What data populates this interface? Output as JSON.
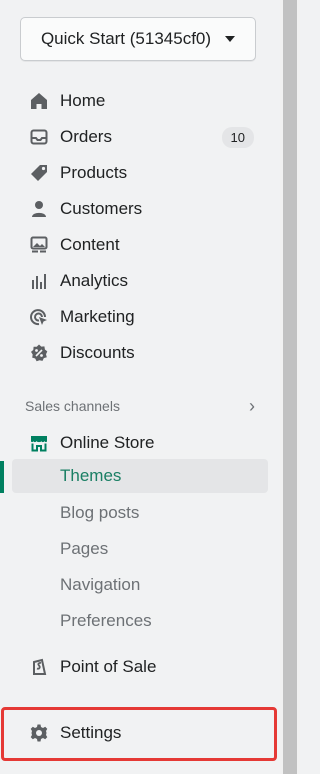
{
  "store_selector": {
    "label": "Quick Start (51345cf0)"
  },
  "main_nav": [
    {
      "label": "Home",
      "icon": "home-icon"
    },
    {
      "label": "Orders",
      "icon": "orders-icon",
      "badge": "10"
    },
    {
      "label": "Products",
      "icon": "products-icon"
    },
    {
      "label": "Customers",
      "icon": "customers-icon"
    },
    {
      "label": "Content",
      "icon": "content-icon"
    },
    {
      "label": "Analytics",
      "icon": "analytics-icon"
    },
    {
      "label": "Marketing",
      "icon": "marketing-icon"
    },
    {
      "label": "Discounts",
      "icon": "discounts-icon"
    }
  ],
  "sales_channels": {
    "title": "Sales channels",
    "online_store": {
      "label": "Online Store",
      "icon": "store-icon"
    },
    "sub_items": [
      {
        "label": "Themes",
        "active": true
      },
      {
        "label": "Blog posts"
      },
      {
        "label": "Pages"
      },
      {
        "label": "Navigation"
      },
      {
        "label": "Preferences"
      }
    ],
    "point_of_sale": {
      "label": "Point of Sale",
      "icon": "pos-icon"
    }
  },
  "settings": {
    "label": "Settings",
    "icon": "settings-icon"
  },
  "colors": {
    "accent": "#008060",
    "active_text": "#1a7f64",
    "highlight": "#e53935"
  }
}
